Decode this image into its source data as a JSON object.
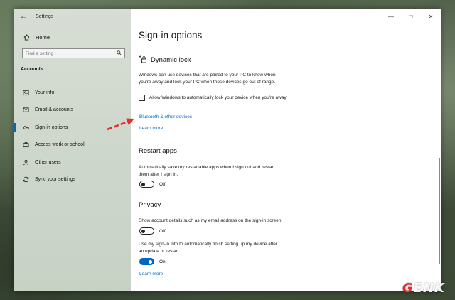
{
  "window": {
    "app_title": "Settings",
    "controls": [
      "minimize",
      "maximize",
      "close"
    ]
  },
  "sidebar": {
    "home_label": "Home",
    "search_placeholder": "Find a setting",
    "section_label": "Accounts",
    "items": [
      {
        "label": "Your info",
        "icon": "person-icon",
        "active": false
      },
      {
        "label": "Email & accounts",
        "icon": "mail-icon",
        "active": false
      },
      {
        "label": "Sign-in options",
        "icon": "key-icon",
        "active": true
      },
      {
        "label": "Access work or school",
        "icon": "briefcase-icon",
        "active": false
      },
      {
        "label": "Other users",
        "icon": "people-icon",
        "active": false
      },
      {
        "label": "Sync your settings",
        "icon": "sync-icon",
        "active": false
      }
    ]
  },
  "main": {
    "page_title": "Sign-in options",
    "dynamic_lock": {
      "title": "Dynamic lock",
      "desc_line1": "Windows can use devices that are paired to your PC to know when",
      "desc_line2": "you're away and lock your PC when those devices go out of range.",
      "checkbox_label": "Allow Windows to automatically lock your device when you're away",
      "checkbox_checked": false,
      "link_bluetooth": "Bluetooth & other devices",
      "link_learn_more": "Learn more"
    },
    "restart_apps": {
      "title": "Restart apps",
      "desc_line1": "Automatically save my restartable apps when I sign out and restart",
      "desc_line2": "them after I sign in.",
      "toggle_state": "Off"
    },
    "privacy": {
      "title": "Privacy",
      "desc1": "Show account details such as my email address on the sign-in screen.",
      "toggle1_state": "Off",
      "desc2_line1": "Use my sign-in info to automatically finish setting up my device after",
      "desc2_line2": "an update or restart.",
      "toggle2_state": "On",
      "link_learn_more": "Learn more"
    }
  },
  "annotation": {
    "color": "#e0312d"
  },
  "watermark": {
    "text_g": "G",
    "text_rest": "ENK"
  },
  "colors": {
    "accent": "#0067c0",
    "sidebar_bg": "#cfd7cd"
  }
}
